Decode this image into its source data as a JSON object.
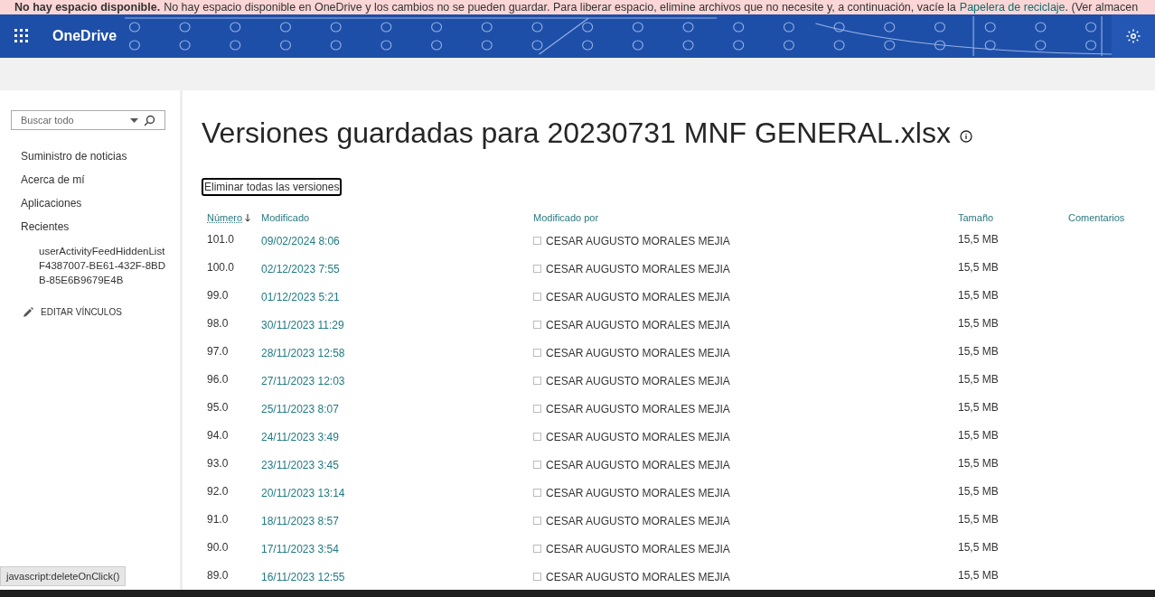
{
  "banner": {
    "title": "No hay espacio disponible.",
    "message": "No hay espacio disponible en OneDrive y los cambios no se pueden guardar. Para liberar espacio, elimine archivos que no necesite y, a continuación, vacíe la",
    "link": "Papelera de reciclaje",
    "tail": ". (Ver almacen"
  },
  "header": {
    "app_name": "OneDrive"
  },
  "sidebar": {
    "search": {
      "placeholder": "Buscar todo"
    },
    "items": [
      {
        "label": "Suministro de noticias"
      },
      {
        "label": "Acerca de mí"
      },
      {
        "label": "Aplicaciones"
      },
      {
        "label": "Recientes",
        "children": [
          {
            "label": "userActivityFeedHiddenListF4387007-BE61-432F-8BDB-85E6B9679E4B"
          }
        ]
      }
    ],
    "edit_links": "EDITAR VÍNCULOS"
  },
  "page_title": "Versiones guardadas para 20230731 MNF GENERAL.xlsx",
  "delete_all_button": "Eliminar todas las versiones",
  "table": {
    "columns": [
      {
        "label": "Número",
        "sorted": true
      },
      {
        "label": "Modificado",
        "sorted": false
      },
      {
        "label": "Modificado por",
        "sorted": false
      },
      {
        "label": "Tamaño",
        "sorted": false
      },
      {
        "label": "Comentarios",
        "sorted": false
      }
    ],
    "rows": [
      {
        "number": "101.0",
        "modified": "09/02/2024 8:06",
        "modified_by": "CESAR AUGUSTO MORALES MEJIA",
        "size": "15,5 MB"
      },
      {
        "number": "100.0",
        "modified": "02/12/2023 7:55",
        "modified_by": "CESAR AUGUSTO MORALES MEJIA",
        "size": "15,5 MB"
      },
      {
        "number": "99.0",
        "modified": "01/12/2023 5:21",
        "modified_by": "CESAR AUGUSTO MORALES MEJIA",
        "size": "15,5 MB"
      },
      {
        "number": "98.0",
        "modified": "30/11/2023 11:29",
        "modified_by": "CESAR AUGUSTO MORALES MEJIA",
        "size": "15,5 MB"
      },
      {
        "number": "97.0",
        "modified": "28/11/2023 12:58",
        "modified_by": "CESAR AUGUSTO MORALES MEJIA",
        "size": "15,5 MB"
      },
      {
        "number": "96.0",
        "modified": "27/11/2023 12:03",
        "modified_by": "CESAR AUGUSTO MORALES MEJIA",
        "size": "15,5 MB"
      },
      {
        "number": "95.0",
        "modified": "25/11/2023 8:07",
        "modified_by": "CESAR AUGUSTO MORALES MEJIA",
        "size": "15,5 MB"
      },
      {
        "number": "94.0",
        "modified": "24/11/2023 3:49",
        "modified_by": "CESAR AUGUSTO MORALES MEJIA",
        "size": "15,5 MB"
      },
      {
        "number": "93.0",
        "modified": "23/11/2023 3:45",
        "modified_by": "CESAR AUGUSTO MORALES MEJIA",
        "size": "15,5 MB"
      },
      {
        "number": "92.0",
        "modified": "20/11/2023 13:14",
        "modified_by": "CESAR AUGUSTO MORALES MEJIA",
        "size": "15,5 MB"
      },
      {
        "number": "91.0",
        "modified": "18/11/2023 8:57",
        "modified_by": "CESAR AUGUSTO MORALES MEJIA",
        "size": "15,5 MB"
      },
      {
        "number": "90.0",
        "modified": "17/11/2023 3:54",
        "modified_by": "CESAR AUGUSTO MORALES MEJIA",
        "size": "15,5 MB"
      },
      {
        "number": "89.0",
        "modified": "16/11/2023 12:55",
        "modified_by": "CESAR AUGUSTO MORALES MEJIA",
        "size": "15,5 MB"
      }
    ]
  },
  "status_url": "javascript:deleteOnClick()"
}
